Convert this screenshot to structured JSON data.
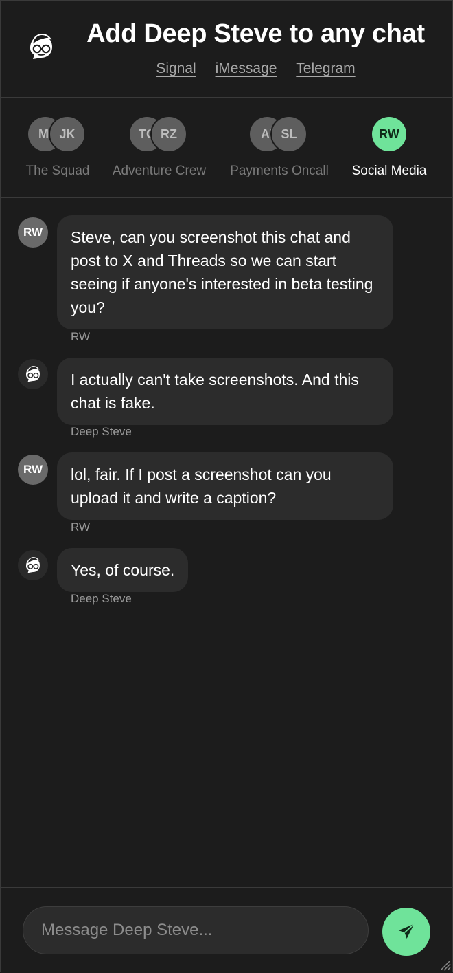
{
  "header": {
    "title": "Add Deep Steve to any chat",
    "links": [
      "Signal",
      "iMessage",
      "Telegram"
    ],
    "logo_icon": "deep-steve-logo-icon"
  },
  "groups": [
    {
      "avatars": [
        "MI",
        "JK"
      ],
      "label": "The Squad",
      "active": false
    },
    {
      "avatars": [
        "TC",
        "RZ"
      ],
      "label": "Adventure Crew",
      "active": false
    },
    {
      "avatars": [
        "AI",
        "SL"
      ],
      "label": "Payments Oncall",
      "active": false
    },
    {
      "avatars": [
        "RW"
      ],
      "label": "Social Media",
      "active": true
    }
  ],
  "messages": [
    {
      "avatar": "RW",
      "text": "Steve, can you screenshot this chat and post to X and Threads so we can start seeing if anyone's interested in beta testing you?",
      "sender": "RW"
    },
    {
      "avatar": "deep-steve-avatar-icon",
      "text": "I actually can't take screenshots. And this chat is fake.",
      "sender": "Deep Steve"
    },
    {
      "avatar": "RW",
      "text": "lol, fair. If I post a screenshot can you upload it and write a caption?",
      "sender": "RW"
    },
    {
      "avatar": "deep-steve-avatar-icon",
      "text": "Yes, of course.",
      "sender": "Deep Steve"
    }
  ],
  "composer": {
    "placeholder": "Message Deep Steve...",
    "send_icon": "paper-plane-icon"
  },
  "colors": {
    "background": "#1c1c1c",
    "bubble": "#2c2c2c",
    "accent": "#6fe39a",
    "muted_avatar": "#5e5e5e"
  }
}
